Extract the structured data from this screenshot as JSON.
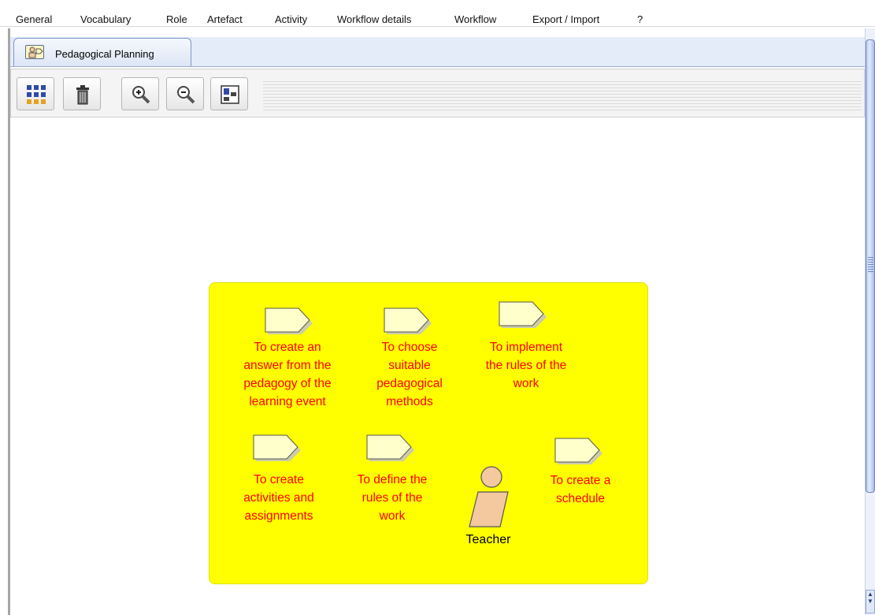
{
  "menu": [
    {
      "label": "General"
    },
    {
      "label": "Vocabulary"
    },
    {
      "label": "Role"
    },
    {
      "label": "Artefact"
    },
    {
      "label": "Activity"
    },
    {
      "label": "Workflow details"
    },
    {
      "label": "Workflow"
    },
    {
      "label": "Export / Import"
    },
    {
      "label": "?"
    }
  ],
  "tabs": [
    {
      "label": "Pedagogical Planning",
      "icon": "diagram-tab-icon",
      "active": true
    }
  ],
  "toolbar": {
    "buttons": [
      {
        "icon": "grid-layout-icon"
      },
      {
        "icon": "trash-icon"
      },
      {
        "icon": "zoom-in-icon"
      },
      {
        "icon": "zoom-out-icon"
      },
      {
        "icon": "fit-to-page-icon"
      }
    ]
  },
  "diagram": {
    "background": "#ffff00",
    "label_color": "#ff0000",
    "activities": [
      {
        "label": "To create an\nanswer from the\npedagogy of the\nlearning event",
        "icon": "activity-pentagon-icon"
      },
      {
        "label": "To choose\nsuitable\npedagogical\nmethods",
        "icon": "activity-pentagon-icon"
      },
      {
        "label": "To implement\nthe rules of the\nwork",
        "icon": "activity-pentagon-icon"
      },
      {
        "label": "To create\nactivities and\nassignments",
        "icon": "activity-pentagon-icon"
      },
      {
        "label": "To define the\nrules of the\nwork",
        "icon": "activity-pentagon-icon"
      },
      {
        "label": "To create a\nschedule",
        "icon": "activity-pentagon-icon"
      }
    ],
    "role": {
      "label": "Teacher",
      "icon": "role-person-icon"
    }
  }
}
